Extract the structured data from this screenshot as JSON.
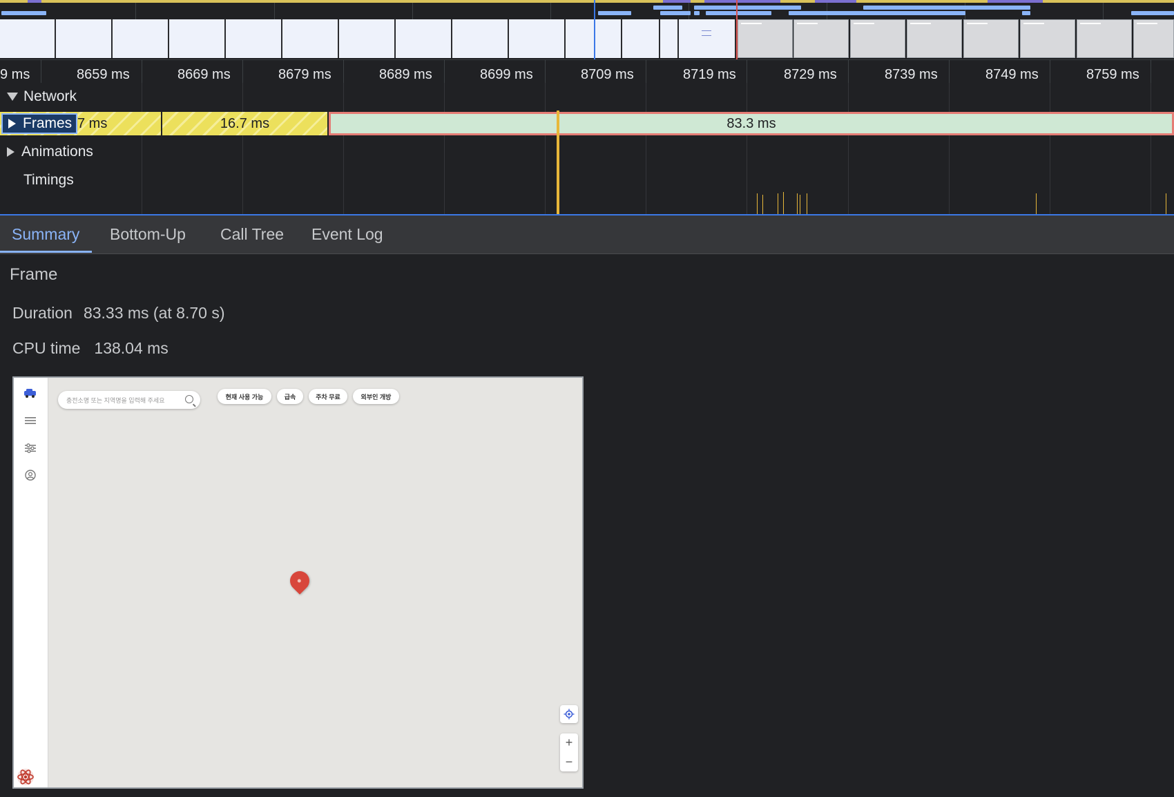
{
  "ruler": {
    "ticks": [
      "9 ms",
      "8659 ms",
      "8669 ms",
      "8679 ms",
      "8689 ms",
      "8699 ms",
      "8709 ms",
      "8719 ms",
      "8729 ms",
      "8739 ms",
      "8749 ms",
      "8759 ms"
    ]
  },
  "tracks": {
    "network_label": "Network",
    "frames_label": "Frames",
    "animations_label": "Animations",
    "timings_label": "Timings",
    "frame_blocks": [
      "7 ms",
      "16.7 ms",
      "83.3 ms"
    ]
  },
  "tabs": [
    "Summary",
    "Bottom-Up",
    "Call Tree",
    "Event Log"
  ],
  "active_tab": "Summary",
  "summary": {
    "title": "Frame",
    "duration_label": "Duration",
    "duration_value": "83.33 ms (at 8.70 s)",
    "cpu_label": "CPU time",
    "cpu_value": "138.04 ms"
  },
  "preview": {
    "search_placeholder": "충전소명 또는 지역명을 입력해 주세요",
    "chips": [
      "현재 사용 가능",
      "급속",
      "주차 무료",
      "외부인 개방"
    ],
    "zoom_in": "+",
    "zoom_out": "−"
  },
  "colors": {
    "accent": "#8ab4f8",
    "frame_yellow": "#ece05c",
    "frame_green": "#cfe8d4",
    "frame_selected_border": "#e57c75",
    "timing_marker": "#e8b73a",
    "map_pin": "#d8463b"
  },
  "icons": {
    "logo": "car-logo-icon",
    "menu": "menu-icon",
    "filter": "sliders-icon",
    "profile": "user-circle-icon",
    "search": "search-icon",
    "locate": "crosshair-icon",
    "react": "react-logo-icon"
  }
}
